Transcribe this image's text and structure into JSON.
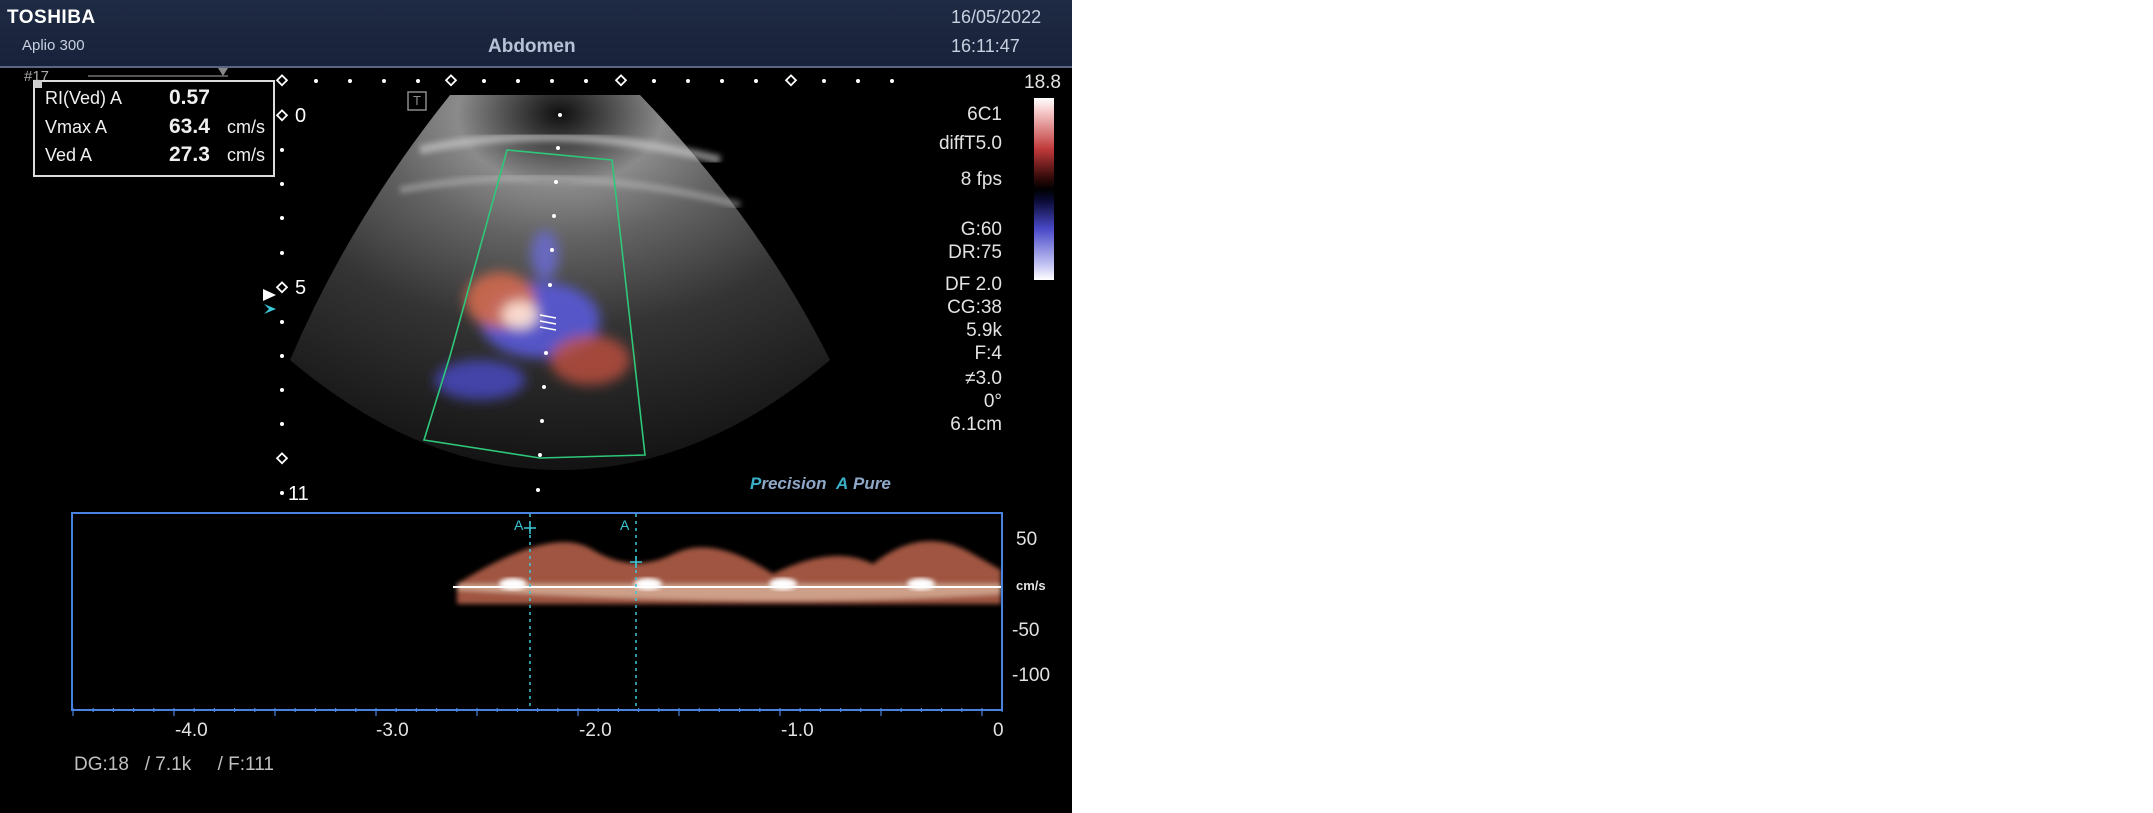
{
  "header": {
    "brand": "TOSHIBA",
    "model": "Aplio 300",
    "preset": "Abdomen",
    "date": "16/05/2022",
    "time": "16:11:47"
  },
  "frame_number": "#17",
  "measurements": [
    {
      "label": "RI(Ved) A",
      "value": "0.57",
      "unit": ""
    },
    {
      "label": "Vmax A",
      "value": "63.4",
      "unit": "cm/s"
    },
    {
      "label": "Ved A",
      "value": "27.3",
      "unit": "cm/s"
    }
  ],
  "depth_labels": [
    "0",
    "5",
    "11"
  ],
  "probe_marker": "T",
  "params": {
    "scale_max": "18.8",
    "probe": "6C1",
    "mode": "diffT5.0",
    "fps": "8 fps",
    "gain": "G:60",
    "dynamic_range": "DR:75",
    "df": "DF 2.0",
    "cg": "CG:38",
    "prf": "5.9k",
    "filter": "F:4",
    "wall": "≠3.0",
    "angle": "0°",
    "depth": "6.1cm"
  },
  "trademark": {
    "p": "P",
    "precision": "recision",
    "a": "A",
    "pure": "Pure"
  },
  "doppler": {
    "velocity_labels": [
      "50",
      "cm/s",
      "-50",
      "-100"
    ],
    "time_labels": [
      "-4.0",
      "-3.0",
      "-2.0",
      "-1.0",
      "0"
    ],
    "caliper_labels": [
      "A",
      "A"
    ],
    "footer": "DG:18   / 7.1k     / F:111"
  },
  "colors": {
    "header_bg": "#1f2a44",
    "doppler_frame": "#4a82e0",
    "caliper": "#3ac8d8",
    "flow_red": "#d26a4e",
    "flow_blue": "#5a5ad8",
    "roi_outline": "#2ec87a"
  },
  "icons": [
    "probe-orientation-icon",
    "focus-marker-icon",
    "caliper-cross-icon"
  ]
}
